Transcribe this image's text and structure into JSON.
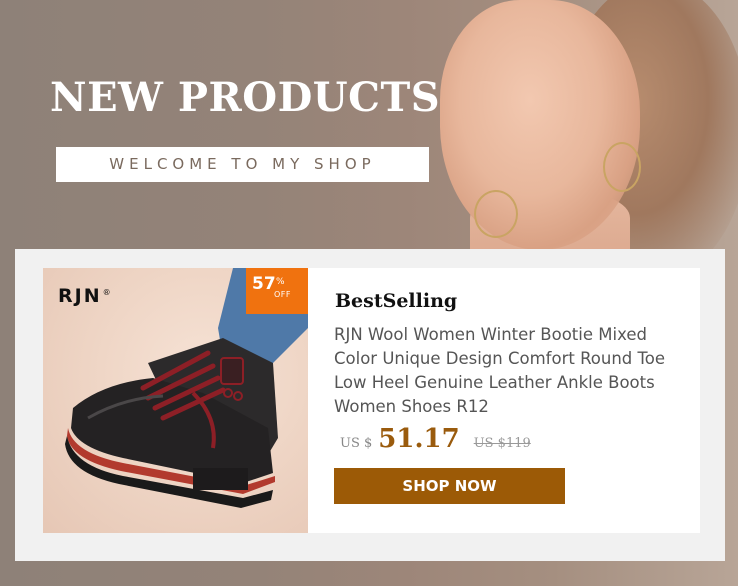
{
  "banner": {
    "headline": "NEW PRODUCTS",
    "welcome": "WELCOME TO MY SHOP"
  },
  "product": {
    "brand_logo": "RJN",
    "brand_mark": "®",
    "discount": {
      "value": "57",
      "percent": "%",
      "off": "OFF"
    },
    "tag": "BestSelling",
    "title": "RJN Wool Women Winter Bootie Mixed Color Unique Design Comfort Round Toe Low Heel Genuine Leather Ankle Boots Women Shoes R12",
    "currency": "US $",
    "price": "51.17",
    "old_price": "US $119",
    "cta_label": "SHOP NOW"
  },
  "colors": {
    "accent": "#9c5a06",
    "discount_badge": "#f0720f",
    "price": "#9a5b0d"
  }
}
